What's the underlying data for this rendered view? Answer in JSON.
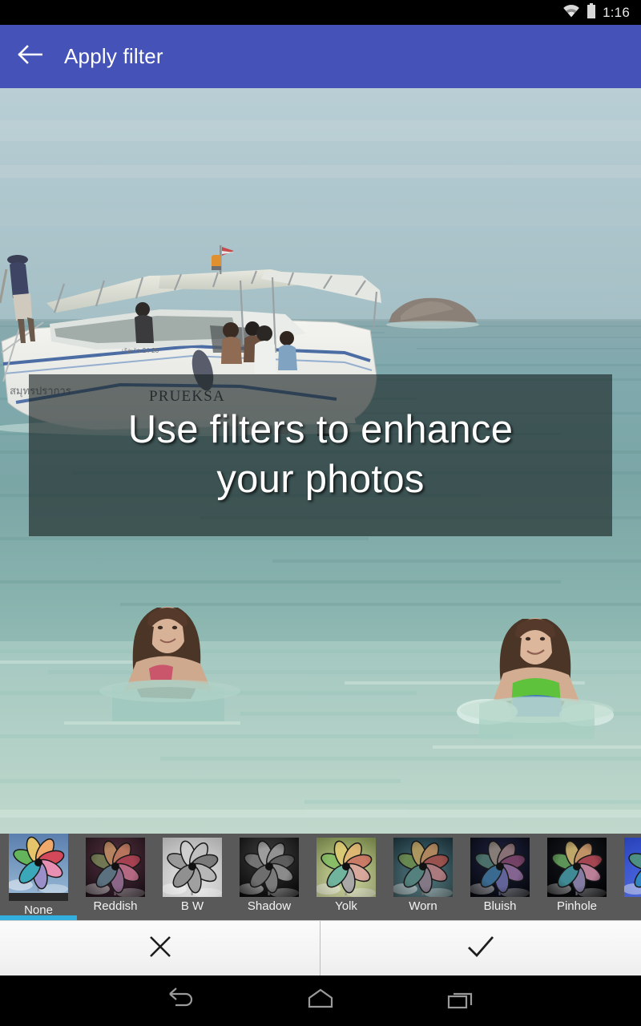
{
  "statusbar": {
    "clock": "1:16",
    "icons": [
      "wifi-icon",
      "battery-icon"
    ]
  },
  "actionbar": {
    "back_icon": "arrow-back-icon",
    "title": "Apply filter",
    "color": "#4553b8"
  },
  "photo": {
    "alt": "Speedboat named PRUEKSA anchored in turquoise sea with two girls swimming in the foreground",
    "boat_name": "PRUEKSA",
    "engine_label": "200",
    "overlay": {
      "line1": "Use filters to enhance",
      "line2": "your photos",
      "background": "rgba(22,32,32,0.62)",
      "text_color": "#ffffff"
    }
  },
  "filterstrip": {
    "background": "#595959",
    "selected_index": 0,
    "selection_color": "#33afdd",
    "items": [
      {
        "label": "None",
        "thumb": "pinwheel-thumb-none"
      },
      {
        "label": "Reddish",
        "thumb": "pinwheel-thumb-reddish"
      },
      {
        "label": "B W",
        "thumb": "pinwheel-thumb-bw"
      },
      {
        "label": "Shadow",
        "thumb": "pinwheel-thumb-shadow"
      },
      {
        "label": "Yolk",
        "thumb": "pinwheel-thumb-yolk"
      },
      {
        "label": "Worn",
        "thumb": "pinwheel-thumb-worn"
      },
      {
        "label": "Bluish",
        "thumb": "pinwheel-thumb-bluish"
      },
      {
        "label": "Pinhole",
        "thumb": "pinwheel-thumb-pinhole"
      },
      {
        "label": "",
        "thumb": "pinwheel-thumb-partial"
      }
    ]
  },
  "confirmbar": {
    "cancel_icon": "close-icon",
    "accept_icon": "check-icon"
  },
  "navbar": {
    "back_icon": "nav-back-icon",
    "home_icon": "nav-home-icon",
    "recents_icon": "nav-recents-icon"
  }
}
